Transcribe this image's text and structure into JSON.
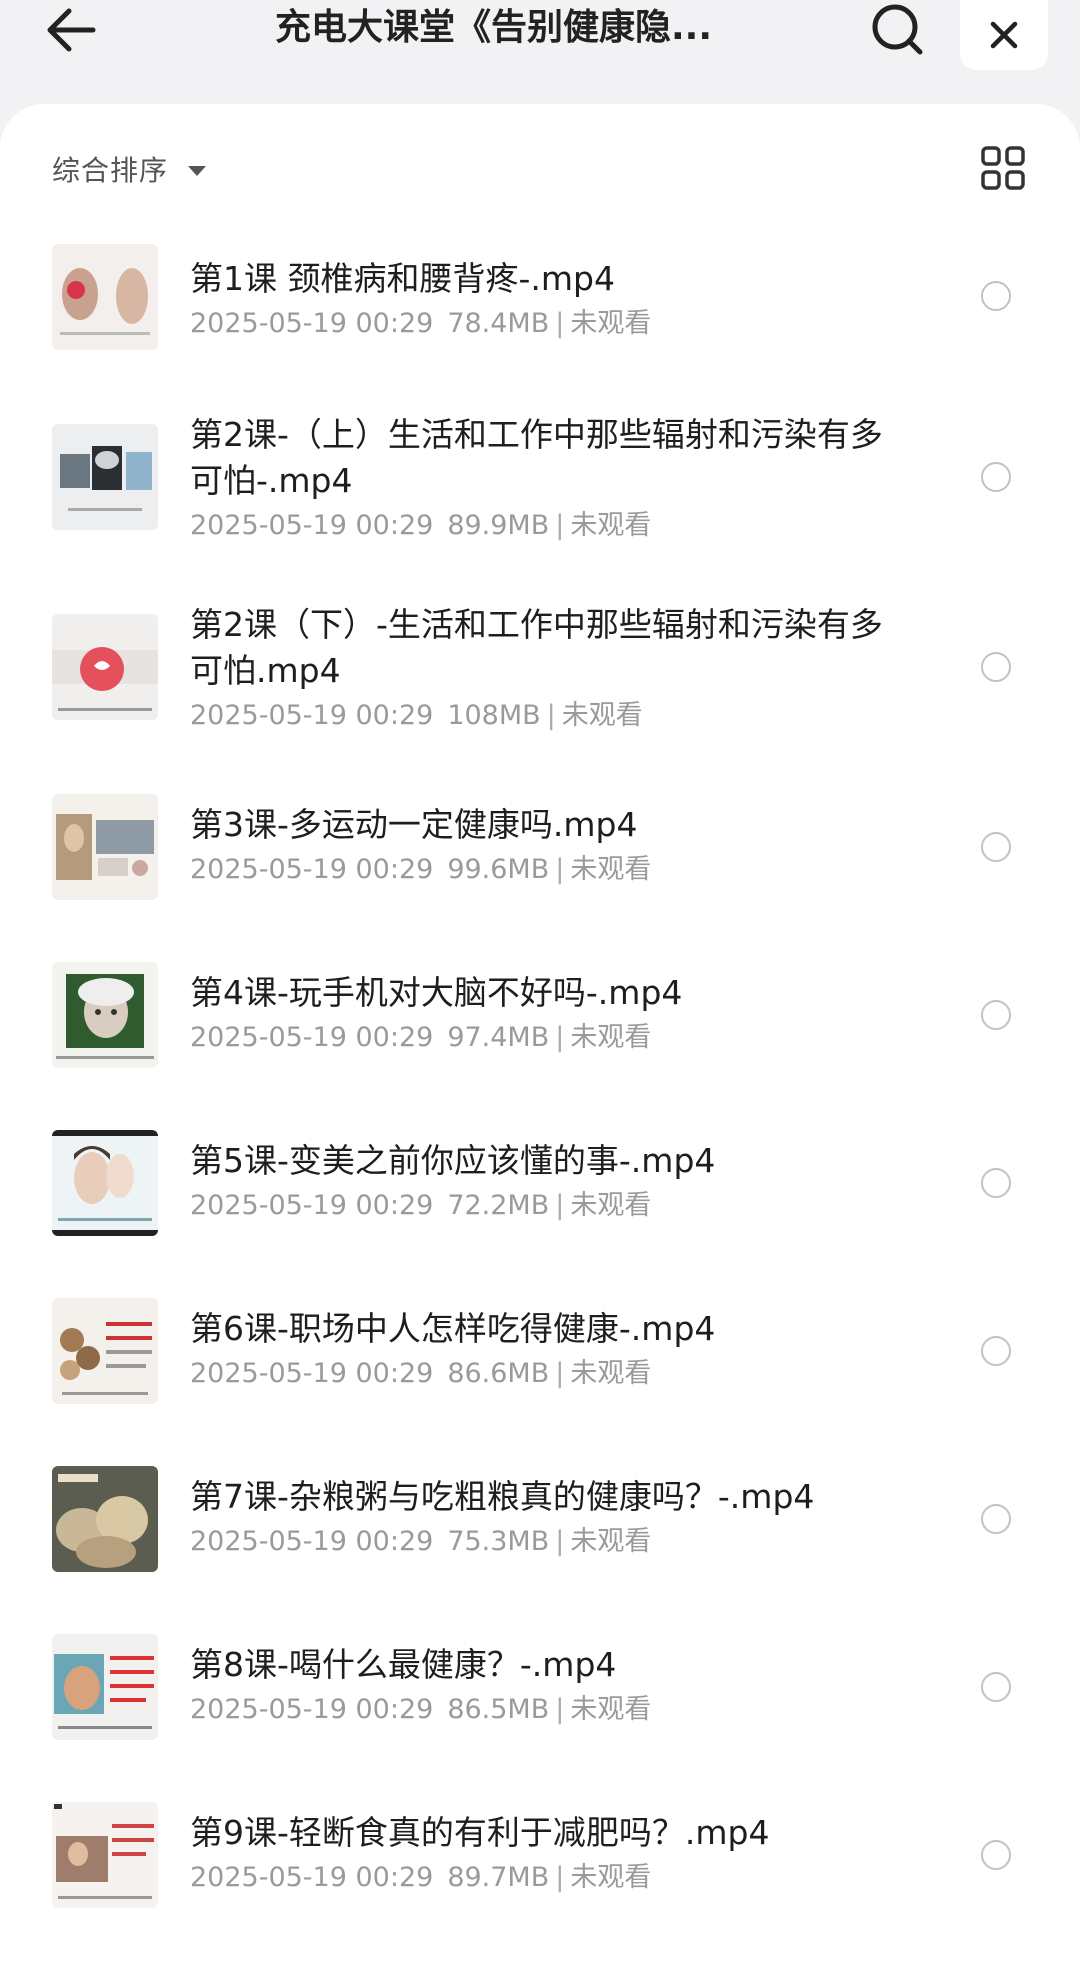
{
  "header": {
    "title": "充电大课堂《告别健康隐...",
    "back_icon": "arrow-left-icon",
    "search_icon": "search-icon",
    "close_icon": "close-icon"
  },
  "toolbar": {
    "sort_label": "综合排序",
    "view_icon": "grid-view-icon"
  },
  "files": [
    {
      "name": "第1课 颈椎病和腰背疼-.mp4",
      "date": "2025-05-19 00:29",
      "size": "78.4MB",
      "status": "未观看"
    },
    {
      "name": "第2课-（上）生活和工作中那些辐射和污染有多可怕-.mp4",
      "date": "2025-05-19 00:29",
      "size": "89.9MB",
      "status": "未观看"
    },
    {
      "name": "第2课（下）-生活和工作中那些辐射和污染有多可怕.mp4",
      "date": "2025-05-19 00:29",
      "size": "108MB",
      "status": "未观看"
    },
    {
      "name": "第3课-多运动一定健康吗.mp4",
      "date": "2025-05-19 00:29",
      "size": "99.6MB",
      "status": "未观看"
    },
    {
      "name": "第4课-玩手机对大脑不好吗-.mp4",
      "date": "2025-05-19 00:29",
      "size": "97.4MB",
      "status": "未观看"
    },
    {
      "name": "第5课-变美之前你应该懂的事-.mp4",
      "date": "2025-05-19 00:29",
      "size": "72.2MB",
      "status": "未观看"
    },
    {
      "name": "第6课-职场中人怎样吃得健康-.mp4",
      "date": "2025-05-19 00:29",
      "size": "86.6MB",
      "status": "未观看"
    },
    {
      "name": "第7课-杂粮粥与吃粗粮真的健康吗？-.mp4",
      "date": "2025-05-19 00:29",
      "size": "75.3MB",
      "status": "未观看"
    },
    {
      "name": "第8课-喝什么最健康？-.mp4",
      "date": "2025-05-19 00:29",
      "size": "86.5MB",
      "status": "未观看"
    },
    {
      "name": "第9课-轻断食真的有利于减肥吗？.mp4",
      "date": "2025-05-19 00:29",
      "size": "89.7MB",
      "status": "未观看"
    }
  ],
  "colors": {
    "background": "#f2f2f4",
    "card": "#ffffff",
    "title_text": "#222222",
    "meta_text": "#9a9a9a",
    "radio_border": "#c2c2c2"
  }
}
